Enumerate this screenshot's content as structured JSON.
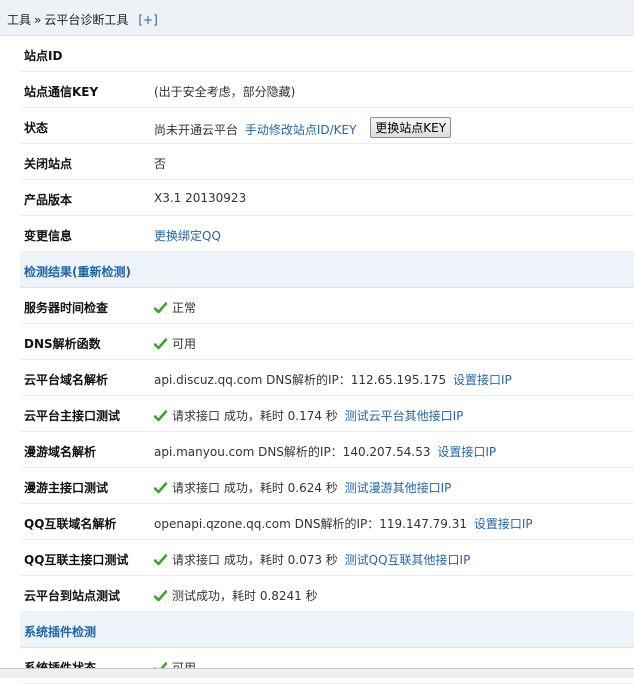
{
  "breadcrumb": {
    "root": "工具",
    "separator": "»",
    "current": "云平台诊断工具",
    "expand": "[+]"
  },
  "rows": {
    "site_id": {
      "label": "站点ID",
      "value": ""
    },
    "comm_key": {
      "label": "站点通信KEY",
      "value": "(出于安全考虑，部分隐藏)"
    },
    "status": {
      "label": "状态",
      "value": "尚未开通云平台",
      "link": "手动修改站点ID/KEY",
      "button": "更换站点KEY"
    },
    "close_site": {
      "label": "关闭站点",
      "value": "否"
    },
    "version": {
      "label": "产品版本",
      "value": "X3.1 20130923"
    },
    "change_info": {
      "label": "变更信息",
      "link": "更换绑定QQ"
    },
    "section_result": {
      "label": "检测结果(重新检测)"
    },
    "server_time": {
      "label": "服务器时间检查",
      "value": "正常"
    },
    "dns_func": {
      "label": "DNS解析函数",
      "value": "可用"
    },
    "cloud_dns": {
      "label": "云平台域名解析",
      "value": "api.discuz.qq.com DNS解析的IP：112.65.195.175",
      "link": "设置接口IP"
    },
    "cloud_api": {
      "label": "云平台主接口测试",
      "value": "请求接口 成功，耗时 0.174 秒",
      "link": "测试云平台其他接口IP"
    },
    "manyou_dns": {
      "label": "漫游域名解析",
      "value": "api.manyou.com DNS解析的IP：140.207.54.53",
      "link": "设置接口IP"
    },
    "manyou_api": {
      "label": "漫游主接口测试",
      "value": "请求接口 成功，耗时 0.624 秒",
      "link": "测试漫游其他接口IP"
    },
    "qq_dns": {
      "label": "QQ互联域名解析",
      "value": "openapi.qzone.qq.com DNS解析的IP：119.147.79.31",
      "link": "设置接口IP"
    },
    "qq_api": {
      "label": "QQ互联主接口测试",
      "value": "请求接口 成功，耗时 0.073 秒",
      "link": "测试QQ互联其他接口IP"
    },
    "cloud_to_site": {
      "label": "云平台到站点测试",
      "value": "测试成功，耗时 0.8241 秒"
    },
    "section_plugin": {
      "label": "系统插件检测"
    },
    "plugin_status": {
      "label": "系统插件状态",
      "value": "可用"
    }
  },
  "colors": {
    "link": "#2366a8",
    "check": "#3aa52a",
    "section_bg": "#eef3f9"
  },
  "icons": {
    "check": "green-checkmark"
  }
}
